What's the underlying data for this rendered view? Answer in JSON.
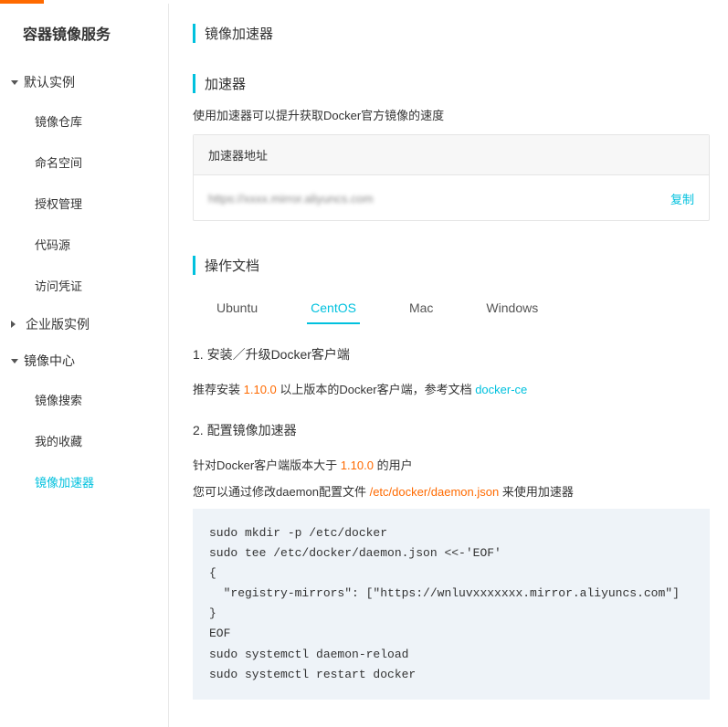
{
  "topbar": {},
  "sidebar": {
    "title": "容器镜像服务",
    "groups": [
      {
        "label": "默认实例",
        "items": [
          "镜像仓库",
          "命名空间",
          "授权管理",
          "代码源",
          "访问凭证"
        ]
      },
      {
        "label": "企业版实例",
        "collapsed": true
      },
      {
        "label": "镜像中心",
        "items": [
          "镜像搜索",
          "我的收藏",
          "镜像加速器"
        ],
        "activeIndex": 2
      }
    ]
  },
  "main": {
    "pageTitle": "镜像加速器",
    "accel": {
      "sectionTitle": "加速器",
      "desc": "使用加速器可以提升获取Docker官方镜像的速度",
      "boxHeader": "加速器地址",
      "urlMasked": "https://xxxx.mirror.aliyuncs.com",
      "copy": "复制"
    },
    "docs": {
      "sectionTitle": "操作文档",
      "tabs": [
        "Ubuntu",
        "CentOS",
        "Mac",
        "Windows"
      ],
      "activeTab": 1,
      "step1Title": "1. 安装／升级Docker客户端",
      "step1Prefix": "推荐安装 ",
      "step1Version": "1.10.0",
      "step1Mid": " 以上版本的Docker客户端，参考文档 ",
      "step1Link": "docker-ce",
      "step2Title": "2. 配置镜像加速器",
      "step2Line1a": "针对Docker客户端版本大于 ",
      "step2Line1b": " 的用户",
      "step2Line2a": "您可以通过修改daemon配置文件 ",
      "step2Path": "/etc/docker/daemon.json",
      "step2Line2b": " 来使用加速器",
      "code": "sudo mkdir -p /etc/docker\nsudo tee /etc/docker/daemon.json <<-'EOF'\n{\n  \"registry-mirrors\": [\"https://wnluvxxxxxxx.mirror.aliyuncs.com\"]\n}\nEOF\nsudo systemctl daemon-reload\nsudo systemctl restart docker"
    }
  }
}
